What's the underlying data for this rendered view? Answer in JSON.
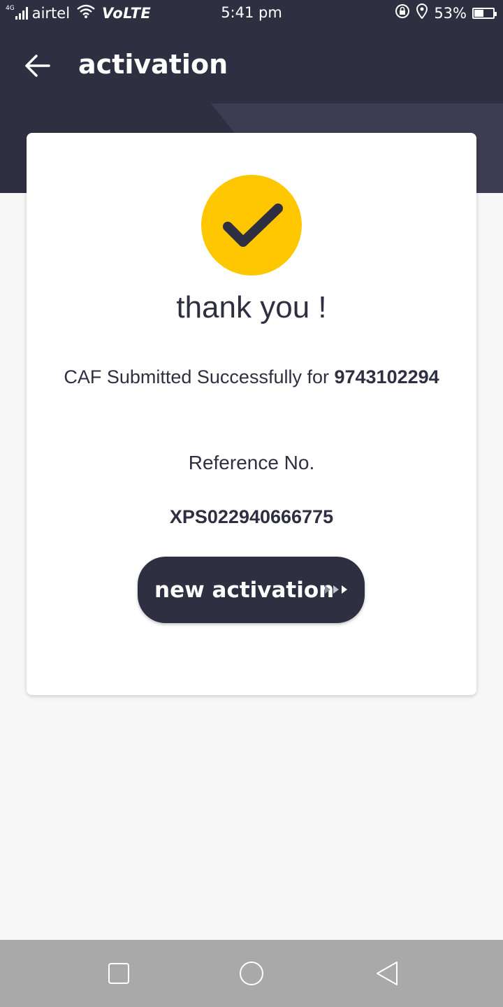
{
  "status_bar": {
    "network_type": "4G",
    "carrier": "airtel",
    "volte": "VoLTE",
    "time": "5:41 pm",
    "battery_percent": "53%",
    "battery_level": 0.53
  },
  "app_bar": {
    "title": "activation",
    "back_icon": "arrow-left-icon"
  },
  "card": {
    "icon": "check-icon",
    "heading": "thank you !",
    "caf_message": "CAF Submitted Successfully for",
    "mobile_number": "9743102294",
    "reference_label": "Reference No.",
    "reference_value": "XPS022940666775",
    "button_label": "new activation",
    "button_icon": "triple-chevron-right-icon"
  },
  "nav_bar": {
    "recent_icon": "square-icon",
    "home_icon": "circle-icon",
    "back_icon": "triangle-back-icon"
  },
  "colors": {
    "header": "#2f2f42",
    "accent": "#fec700",
    "background": "#f7f7f7",
    "nav_bar": "#a9a9a9"
  }
}
